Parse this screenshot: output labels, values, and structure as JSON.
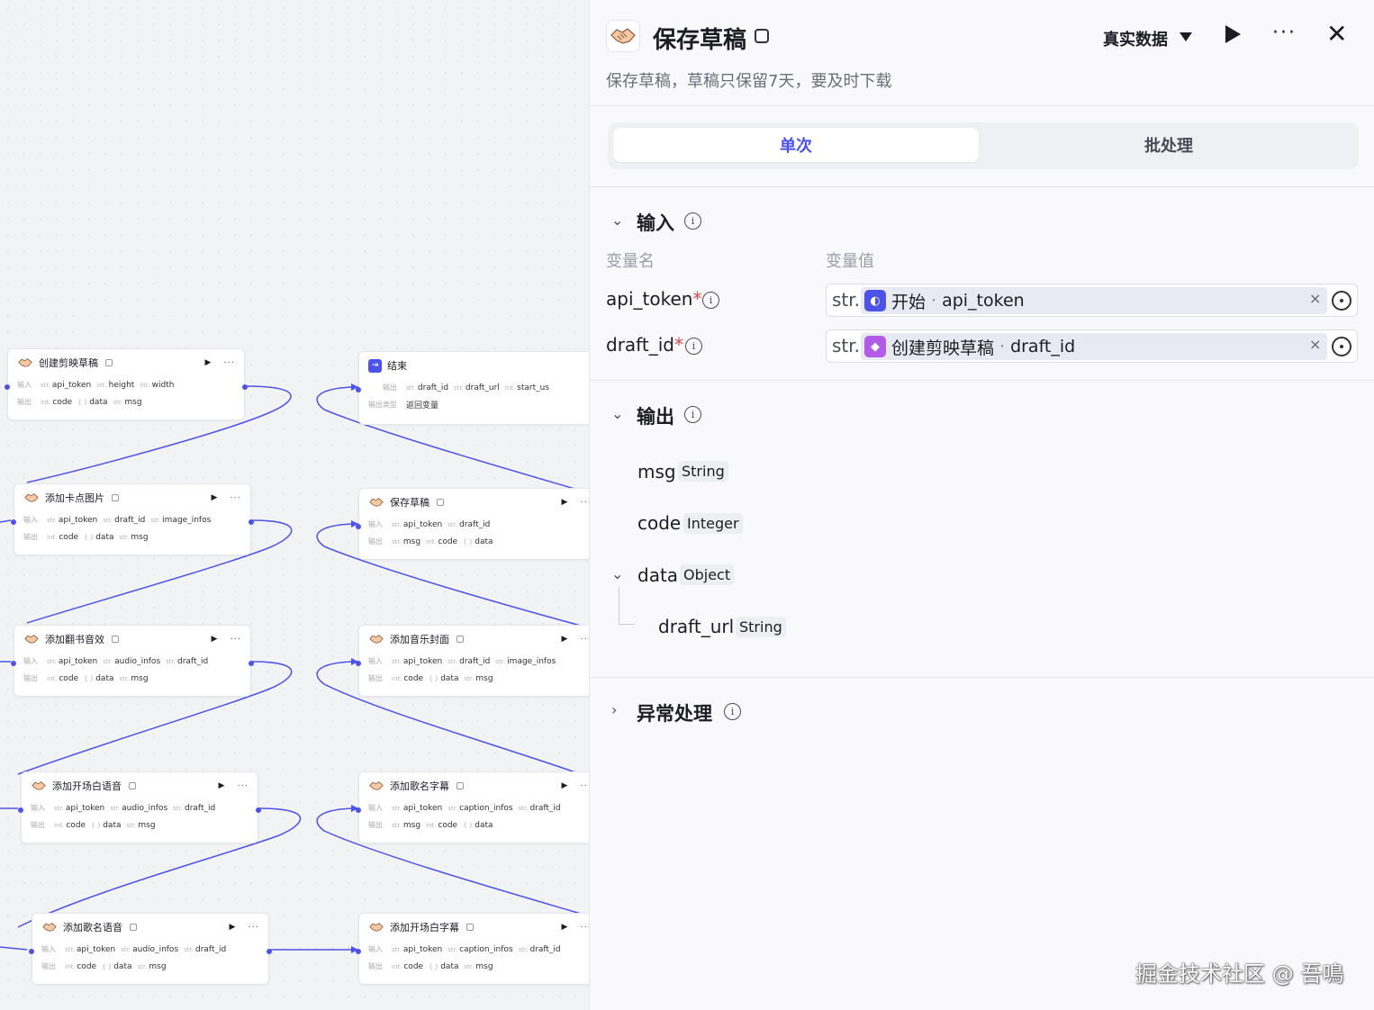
{
  "canvas": {
    "nodes": [
      {
        "id": "create_draft",
        "title": "创建剪映草稿",
        "inputs": [
          {
            "t": "str.",
            "n": "api_token"
          },
          {
            "t": "int.",
            "n": "height"
          },
          {
            "t": "int.",
            "n": "width"
          }
        ],
        "outputs": [
          {
            "t": "int.",
            "n": "code"
          },
          {
            "t": "{ }",
            "n": "data"
          },
          {
            "t": "str.",
            "n": "msg"
          }
        ]
      },
      {
        "id": "add_card_image",
        "title": "添加卡点图片",
        "inputs": [
          {
            "t": "str.",
            "n": "api_token"
          },
          {
            "t": "str.",
            "n": "draft_id"
          },
          {
            "t": "str.",
            "n": "image_infos"
          }
        ],
        "outputs": [
          {
            "t": "int.",
            "n": "code"
          },
          {
            "t": "{ }",
            "n": "data"
          },
          {
            "t": "str.",
            "n": "msg"
          }
        ]
      },
      {
        "id": "add_page_sfx",
        "title": "添加翻书音效",
        "inputs": [
          {
            "t": "str.",
            "n": "api_token"
          },
          {
            "t": "str.",
            "n": "audio_infos"
          },
          {
            "t": "str.",
            "n": "draft_id"
          }
        ],
        "outputs": [
          {
            "t": "int.",
            "n": "code"
          },
          {
            "t": "{ }",
            "n": "data"
          },
          {
            "t": "str.",
            "n": "msg"
          }
        ]
      },
      {
        "id": "add_opening_voice",
        "title": "添加开场白语音",
        "inputs": [
          {
            "t": "str.",
            "n": "api_token"
          },
          {
            "t": "str.",
            "n": "audio_infos"
          },
          {
            "t": "str.",
            "n": "draft_id"
          }
        ],
        "outputs": [
          {
            "t": "int.",
            "n": "code"
          },
          {
            "t": "{ }",
            "n": "data"
          },
          {
            "t": "str.",
            "n": "msg"
          }
        ]
      },
      {
        "id": "add_song_voice",
        "title": "添加歌名语音",
        "inputs": [
          {
            "t": "str.",
            "n": "api_token"
          },
          {
            "t": "str.",
            "n": "audio_infos"
          },
          {
            "t": "str.",
            "n": "draft_id"
          }
        ],
        "outputs": [
          {
            "t": "int.",
            "n": "code"
          },
          {
            "t": "{ }",
            "n": "data"
          },
          {
            "t": "str.",
            "n": "msg"
          }
        ]
      },
      {
        "id": "end",
        "title": "结束",
        "inputs": [
          {
            "t": "str.",
            "n": "draft_id"
          },
          {
            "t": "str.",
            "n": "draft_url"
          },
          {
            "t": "int.",
            "n": "start_us"
          }
        ],
        "outputs": [],
        "extra_label": "输出类型",
        "extra_value": "返回变量",
        "row_label": "输出"
      },
      {
        "id": "save_draft",
        "title": "保存草稿",
        "inputs": [
          {
            "t": "str.",
            "n": "api_token"
          },
          {
            "t": "str.",
            "n": "draft_id"
          }
        ],
        "outputs": [
          {
            "t": "str.",
            "n": "msg"
          },
          {
            "t": "int.",
            "n": "code"
          },
          {
            "t": "{ }",
            "n": "data"
          }
        ]
      },
      {
        "id": "add_music_cover",
        "title": "添加音乐封面",
        "inputs": [
          {
            "t": "str.",
            "n": "api_token"
          },
          {
            "t": "str.",
            "n": "draft_id"
          },
          {
            "t": "str.",
            "n": "image_infos"
          }
        ],
        "outputs": [
          {
            "t": "int.",
            "n": "code"
          },
          {
            "t": "{ }",
            "n": "data"
          },
          {
            "t": "str.",
            "n": "msg"
          }
        ]
      },
      {
        "id": "add_song_caption",
        "title": "添加歌名字幕",
        "inputs": [
          {
            "t": "str.",
            "n": "api_token"
          },
          {
            "t": "str.",
            "n": "caption_infos"
          },
          {
            "t": "str.",
            "n": "draft_id"
          }
        ],
        "outputs": [
          {
            "t": "str.",
            "n": "msg"
          },
          {
            "t": "int.",
            "n": "code"
          },
          {
            "t": "{ }",
            "n": "data"
          }
        ]
      },
      {
        "id": "add_opening_caption",
        "title": "添加开场白字幕",
        "inputs": [
          {
            "t": "str.",
            "n": "api_token"
          },
          {
            "t": "str.",
            "n": "caption_infos"
          },
          {
            "t": "str.",
            "n": "draft_id"
          }
        ],
        "outputs": [
          {
            "t": "int.",
            "n": "code"
          },
          {
            "t": "{ }",
            "n": "data"
          },
          {
            "t": "str.",
            "n": "msg"
          }
        ]
      }
    ],
    "input_label": "输入",
    "output_label": "输出",
    "more_glyph": "···",
    "run_glyph": "▶",
    "accent_color": "#4d53e8"
  },
  "panel": {
    "title": "保存草稿",
    "description": "保存草稿，草稿只保留7天，要及时下载",
    "data_mode": "真实数据",
    "run_icon": "play-icon",
    "more_glyph": "···",
    "close_glyph": "✕",
    "tabs": {
      "single": "单次",
      "batch": "批处理"
    },
    "input_section": {
      "title": "输入",
      "col_name": "变量名",
      "col_value": "变量值",
      "params": [
        {
          "name": "api_token",
          "required": "*",
          "type": "str.",
          "source": "开始",
          "sep": "·",
          "var": "api_token",
          "icon_color": "#4d53e8"
        },
        {
          "name": "draft_id",
          "required": "*",
          "type": "str.",
          "source": "创建剪映草稿",
          "sep": "·",
          "var": "draft_id",
          "icon_color": "#b15be8"
        }
      ],
      "clear_glyph": "×"
    },
    "output_section": {
      "title": "输出",
      "fields": [
        {
          "name": "msg",
          "type": "String"
        },
        {
          "name": "code",
          "type": "Integer"
        },
        {
          "name": "data",
          "type": "Object"
        },
        {
          "name": "draft_url",
          "type": "String"
        }
      ]
    },
    "exception_section": {
      "title": "异常处理"
    },
    "info_glyph": "i"
  },
  "watermark": "掘金技术社区 @ 吾鳴"
}
